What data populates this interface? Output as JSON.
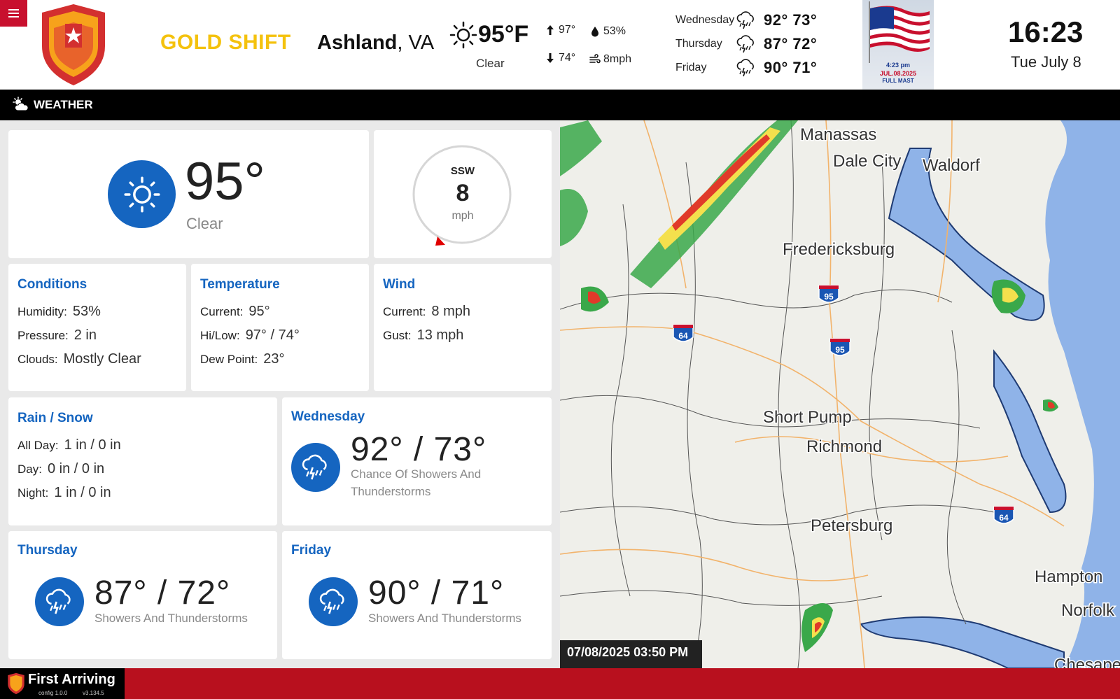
{
  "header": {
    "shift": "GOLD SHIFT",
    "city": "Ashland",
    "state": ", VA",
    "current_temp": "95°F",
    "current_condition": "Clear",
    "high": "97°",
    "low": "74°",
    "humidity": "53%",
    "wind": "8mph",
    "forecast": [
      {
        "day": "Wednesday",
        "temps": "92°  73°"
      },
      {
        "day": "Thursday",
        "temps": "87°  72°"
      },
      {
        "day": "Friday",
        "temps": "90°  71°"
      }
    ],
    "flag": {
      "time": "4:23 pm",
      "date": "JUL.08.2025",
      "mast": "FULL MAST"
    },
    "clock": "16:23",
    "date": "Tue July 8"
  },
  "section": {
    "title": "WEATHER"
  },
  "current": {
    "temp": "95°",
    "condition": "Clear"
  },
  "wind_gauge": {
    "direction": "SSW",
    "speed": "8",
    "unit": "mph"
  },
  "conditions": {
    "title": "Conditions",
    "rows": [
      {
        "k": "Humidity:",
        "v": "53%"
      },
      {
        "k": "Pressure:",
        "v": "2 in"
      },
      {
        "k": "Clouds:",
        "v": "Mostly Clear"
      }
    ]
  },
  "temperature": {
    "title": "Temperature",
    "rows": [
      {
        "k": "Current:",
        "v": "95°"
      },
      {
        "k": "Hi/Low:",
        "v": "97° / 74°"
      },
      {
        "k": "Dew Point:",
        "v": "23°"
      }
    ]
  },
  "wind": {
    "title": "Wind",
    "rows": [
      {
        "k": "Current:",
        "v": "8 mph"
      },
      {
        "k": "Gust:",
        "v": "13 mph"
      }
    ]
  },
  "rain": {
    "title": "Rain / Snow",
    "rows": [
      {
        "k": "All Day:",
        "v": "1 in / 0 in"
      },
      {
        "k": "Day:",
        "v": "0 in / 0 in"
      },
      {
        "k": "Night:",
        "v": "1 in / 0 in"
      }
    ]
  },
  "days": [
    {
      "title": "Wednesday",
      "temps": "92° / 73°",
      "cond1": "Chance Of Showers And",
      "cond2": "Thunderstorms"
    },
    {
      "title": "Thursday",
      "temps": "87° / 72°",
      "cond1": "Showers And Thunderstorms"
    },
    {
      "title": "Friday",
      "temps": "90° / 71°",
      "cond1": "Showers And Thunderstorms"
    }
  ],
  "map": {
    "timestamp": "07/08/2025 03:50 PM",
    "labels": {
      "manassas": "Manassas",
      "dale_city": "Dale City",
      "waldorf": "Waldorf",
      "fredericksburg": "Fredericksburg",
      "short_pump": "Short Pump",
      "richmond": "Richmond",
      "petersburg": "Petersburg",
      "hampton": "Hampton",
      "norfolk": "Norfolk",
      "chesapeake": "Chesapeake"
    },
    "shields": {
      "i95": "95",
      "i64": "64"
    }
  },
  "footer": {
    "brand": "First Arriving",
    "config": "config 1.0.0",
    "version": "v3.134.5"
  }
}
